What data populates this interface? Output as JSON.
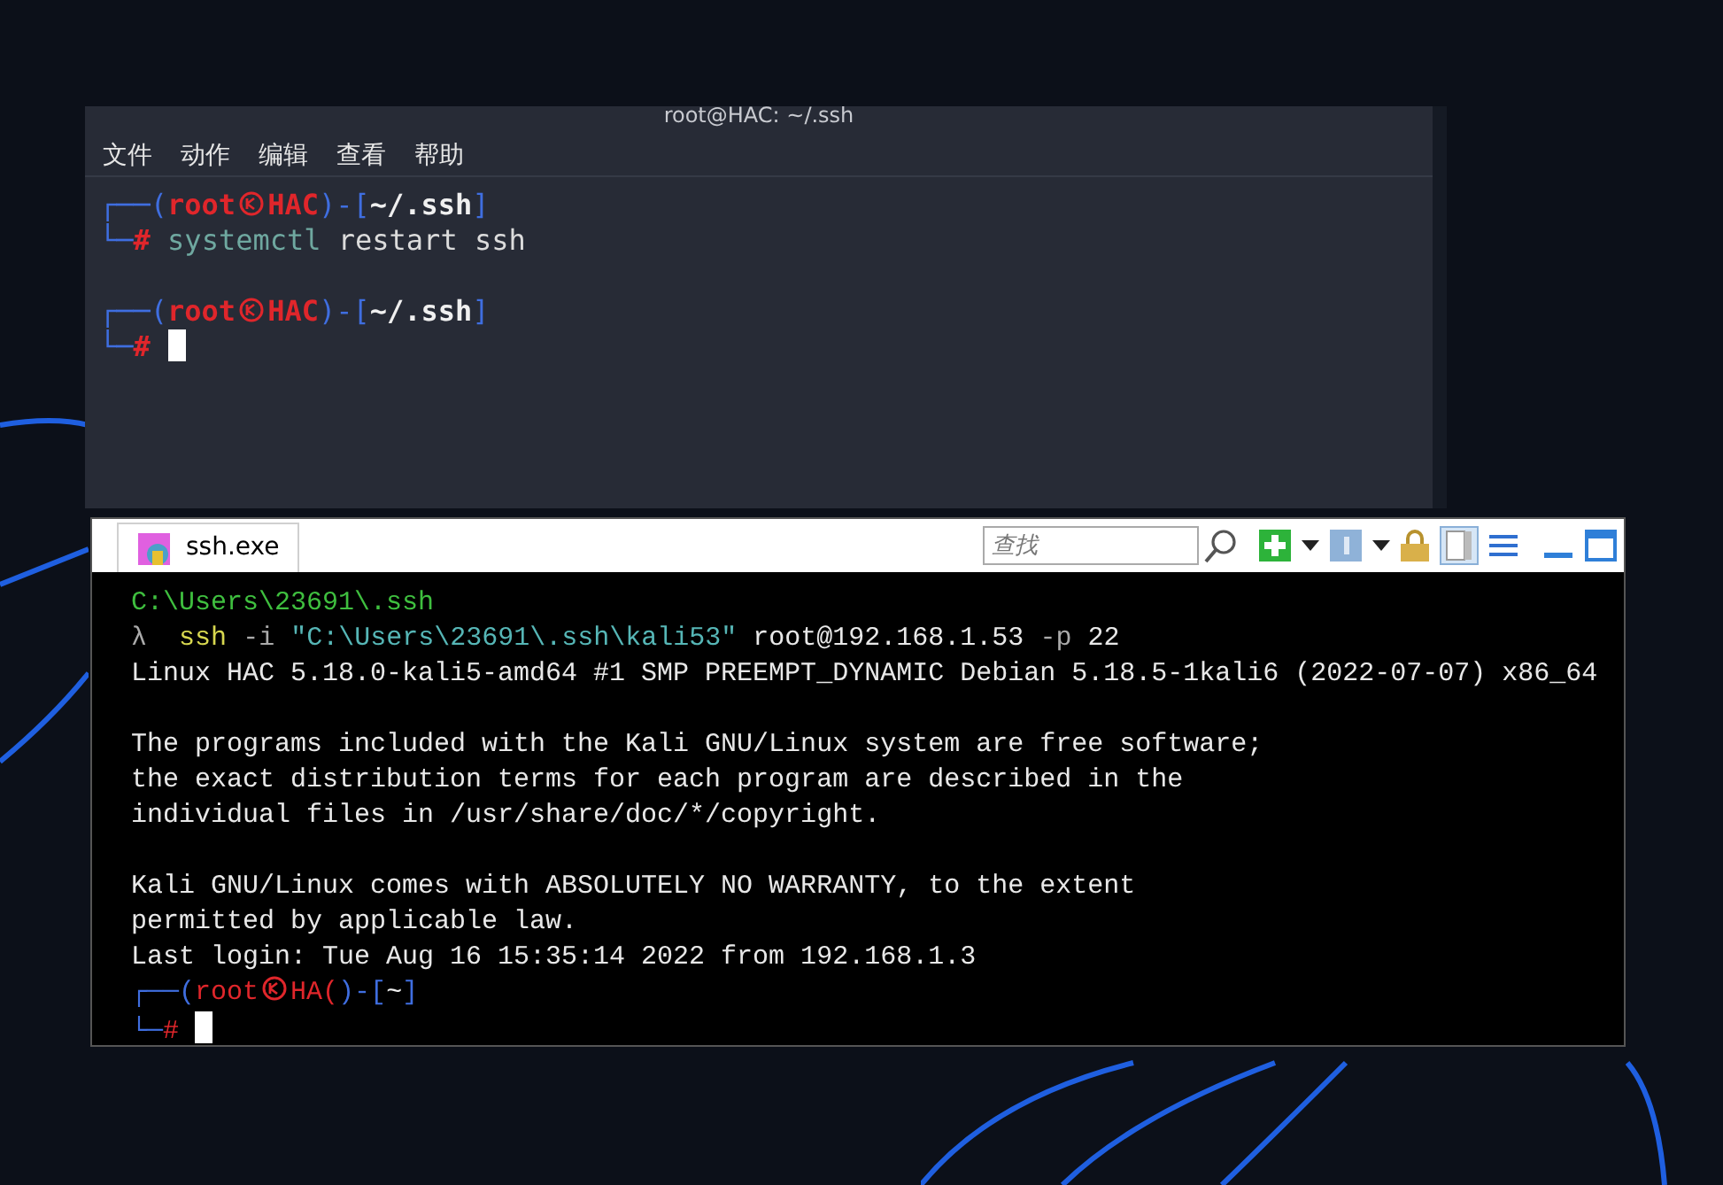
{
  "top_window": {
    "title": "root@HAC: ~/.ssh",
    "menu": [
      "文件",
      "动作",
      "编辑",
      "查看",
      "帮助"
    ],
    "lines": [
      {
        "kind": "prompt",
        "open": "┌──(",
        "user": "root",
        "host": "HAC",
        "mid": ")-[",
        "path": "~/.ssh",
        "close": "]"
      },
      {
        "kind": "command",
        "corner": "└─",
        "sign": "#",
        "program": "systemctl",
        "args": "restart ssh"
      },
      {
        "kind": "blank"
      },
      {
        "kind": "prompt",
        "open": "┌──(",
        "user": "root",
        "host": "HAC",
        "mid": ")-[",
        "path": "~/.ssh",
        "close": "]"
      },
      {
        "kind": "cursor",
        "corner": "└─",
        "sign": "#"
      }
    ]
  },
  "bottom_window": {
    "tab": {
      "label": "ssh.exe",
      "selected": true
    },
    "search": {
      "placeholder": "查找"
    },
    "lines": [
      {
        "kind": "path",
        "text": "C:\\Users\\23691\\.ssh"
      },
      {
        "kind": "segments",
        "segments": [
          {
            "kind": "symbol",
            "text": "λ "
          },
          {
            "kind": "program",
            "text": "ssh"
          },
          {
            "kind": "flag",
            "text": "-i"
          },
          {
            "kind": "string",
            "text": "\"C:\\Users\\23691\\.ssh\\kali53\""
          },
          {
            "kind": "arg",
            "text": "root@192.168.1.53"
          },
          {
            "kind": "flag",
            "text": "-p"
          },
          {
            "kind": "arg",
            "text": "22"
          }
        ]
      },
      {
        "kind": "output",
        "text": "Linux HAC 5.18.0-kali5-amd64 #1 SMP PREEMPT_DYNAMIC Debian 5.18.5-1kali6 (2022-07-07) x86_64"
      },
      {
        "kind": "blank"
      },
      {
        "kind": "output",
        "text": "The programs included with the Kali GNU/Linux system are free software;"
      },
      {
        "kind": "output",
        "text": "the exact distribution terms for each program are described in the"
      },
      {
        "kind": "output",
        "text": "individual files in /usr/share/doc/*/copyright."
      },
      {
        "kind": "blank"
      },
      {
        "kind": "output",
        "text": "Kali GNU/Linux comes with ABSOLUTELY NO WARRANTY, to the extent"
      },
      {
        "kind": "output",
        "text": "permitted by applicable law."
      },
      {
        "kind": "output",
        "text": "Last login: Tue Aug 16 15:35:14 2022 from 192.168.1.3"
      },
      {
        "kind": "prompt",
        "open": "┌──(",
        "user": "root",
        "host": "HA(",
        "mid": ")-[",
        "path": "~",
        "close": "]"
      },
      {
        "kind": "cursor",
        "corner": "└─",
        "sign": "#"
      }
    ]
  }
}
